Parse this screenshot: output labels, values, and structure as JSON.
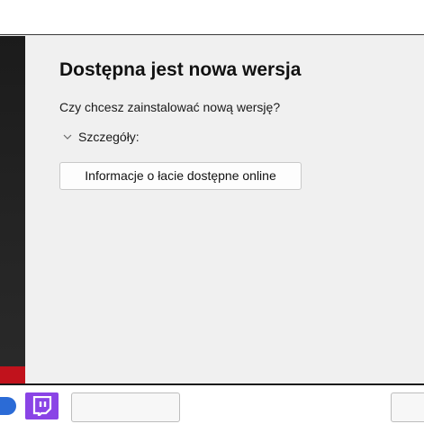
{
  "dialog": {
    "title": "Dostępna jest nowa wersja",
    "question": "Czy chcesz zainstalować nową wersję?",
    "details_label": "Szczegóły:",
    "info_button_label": "Informacje o łacie dostępne online"
  },
  "sidebar_art": {
    "accent_color": "#c1121c"
  },
  "bottom_bar": {
    "icons": [
      "blue-app-icon",
      "twitch-icon"
    ],
    "colors": {
      "blue": "#2b6bd6",
      "twitch": "#8a44e6"
    }
  }
}
